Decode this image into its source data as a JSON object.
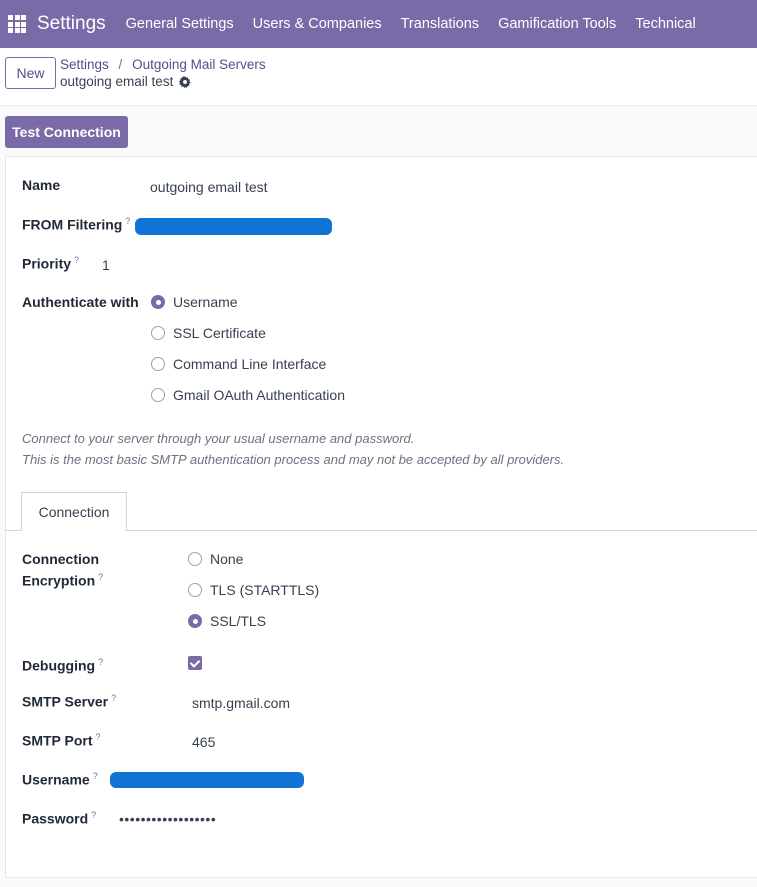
{
  "navbar": {
    "brand": "Settings",
    "menu": [
      "General Settings",
      "Users & Companies",
      "Translations",
      "Gamification Tools",
      "Technical"
    ]
  },
  "control": {
    "new_label": "New",
    "breadcrumb": [
      "Settings",
      "Outgoing Mail Servers"
    ],
    "record_name": "outgoing email test"
  },
  "actions": {
    "test_connection": "Test Connection"
  },
  "form": {
    "name_label": "Name",
    "name_value": "outgoing email test",
    "from_filter_label": "FROM Filtering",
    "priority_label": "Priority",
    "priority_value": "1",
    "auth_label": "Authenticate with",
    "auth_options": [
      "Username",
      "SSL Certificate",
      "Command Line Interface",
      "Gmail OAuth Authentication"
    ],
    "auth_selected": "Username",
    "note_line1": "Connect to your server through your usual username and password.",
    "note_line2": "This is the most basic SMTP authentication process and may not be accepted by all providers."
  },
  "tabs": [
    "Connection"
  ],
  "connection": {
    "encryption_label_1": "Connection",
    "encryption_label_2": "Encryption",
    "encryption_options": [
      "None",
      "TLS (STARTTLS)",
      "SSL/TLS"
    ],
    "encryption_selected": "SSL/TLS",
    "debugging_label": "Debugging",
    "debugging_checked": true,
    "smtp_server_label": "SMTP Server",
    "smtp_server_value": "smtp.gmail.com",
    "smtp_port_label": "SMTP Port",
    "smtp_port_value": "465",
    "username_label": "Username",
    "password_label": "Password",
    "password_value": "••••••••••••••••••"
  },
  "help_mark": "?",
  "colors": {
    "brand": "#7a6aa8",
    "redaction": "#1173d4"
  }
}
